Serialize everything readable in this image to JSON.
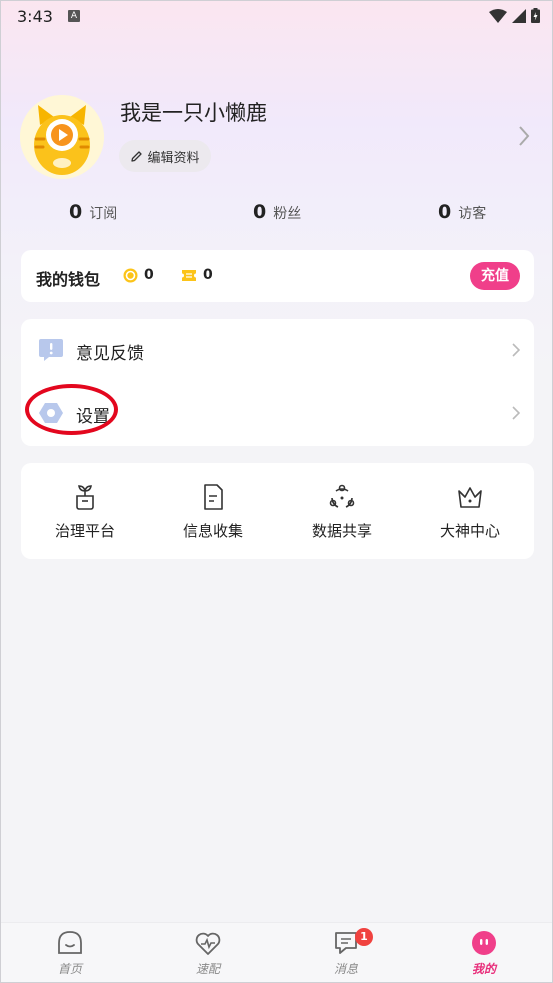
{
  "status_bar": {
    "time": "3:43",
    "notification_letter": "A"
  },
  "profile": {
    "username": "我是一只小懒鹿",
    "edit_label": "编辑资料"
  },
  "stats": [
    {
      "value": "0",
      "label": "订阅"
    },
    {
      "value": "0",
      "label": "粉丝"
    },
    {
      "value": "0",
      "label": "访客"
    }
  ],
  "wallet": {
    "title": "我的钱包",
    "coins": "0",
    "tickets": "0",
    "recharge_label": "充值"
  },
  "menu": [
    {
      "label": "意见反馈",
      "icon": "feedback-icon"
    },
    {
      "label": "设置",
      "icon": "settings-icon"
    }
  ],
  "tools": [
    {
      "label": "治理平台",
      "icon": "plant-icon"
    },
    {
      "label": "信息收集",
      "icon": "document-icon"
    },
    {
      "label": "数据共享",
      "icon": "share-icon"
    },
    {
      "label": "大神中心",
      "icon": "crown-icon"
    }
  ],
  "bottom_nav": [
    {
      "label": "首页",
      "icon": "home-icon"
    },
    {
      "label": "速配",
      "icon": "heart-pulse-icon"
    },
    {
      "label": "消息",
      "icon": "message-icon",
      "badge": "1"
    },
    {
      "label": "我的",
      "icon": "profile-icon",
      "active": true
    }
  ],
  "colors": {
    "accent": "#f03f8a",
    "highlight_ring": "#e3071e",
    "badge": "#f0423f"
  }
}
